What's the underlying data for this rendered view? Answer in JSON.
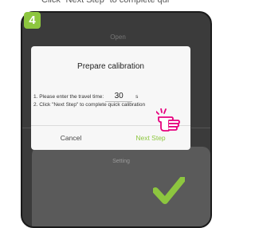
{
  "instruction": {
    "step_number": "4",
    "text": "Click “Next Step” to complete quick calibration"
  },
  "app": {
    "header_label": "Open",
    "setting_label": "Setting"
  },
  "dialog": {
    "title": "Prepare calibration",
    "line1_prefix": "1. Please enter the travel time:",
    "travel_time_value": "30",
    "travel_time_unit": "s",
    "line2": "2. Click \"Next Step\" to complete quick calibration",
    "cancel_label": "Cancel",
    "next_label": "Next Step"
  },
  "colors": {
    "accent_green": "#8dc63f",
    "pointer_pink": "#e6007e",
    "screen_dark": "#3b3b3b"
  },
  "icons": [
    "pointing-hand-icon",
    "checkmark-icon"
  ]
}
